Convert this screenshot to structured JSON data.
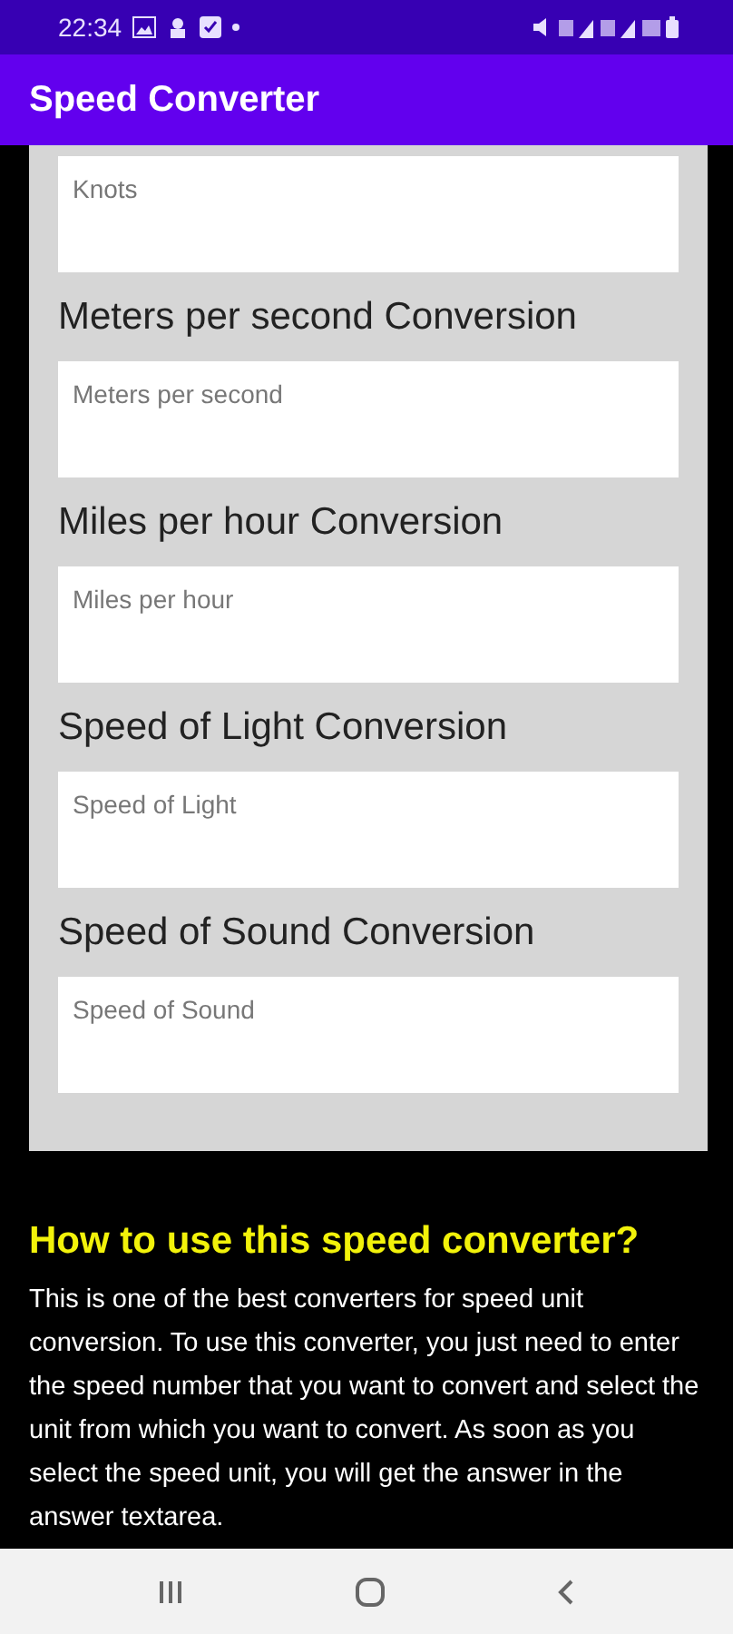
{
  "status_bar": {
    "time": "22:34"
  },
  "app_bar": {
    "title": "Speed Converter"
  },
  "conversions": [
    {
      "placeholder": "Knots"
    },
    {
      "heading": "Meters per second Conversion",
      "placeholder": "Meters per second"
    },
    {
      "heading": "Miles per hour Conversion",
      "placeholder": "Miles per hour"
    },
    {
      "heading": "Speed of Light Conversion",
      "placeholder": "Speed of Light"
    },
    {
      "heading": "Speed of Sound Conversion",
      "placeholder": "Speed of Sound"
    }
  ],
  "help": {
    "title": "How to use this speed converter?",
    "text": "This is one of the best converters for speed unit conversion. To use this converter, you just need to enter the speed number that you want to convert and select the unit from which you want to convert. As soon as you select the speed unit, you will get the answer in the answer textarea."
  }
}
